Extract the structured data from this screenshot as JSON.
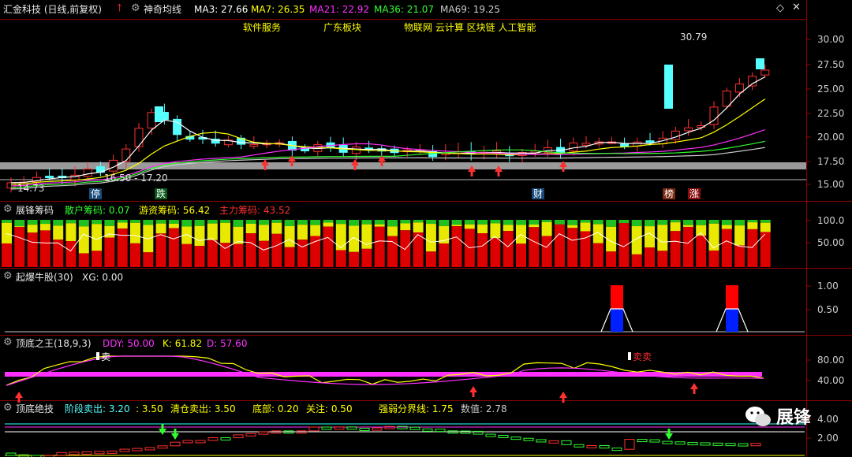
{
  "colors": {
    "up_red": "#ff3030",
    "down_cyan": "#55ffff",
    "ma3": "#ffffff",
    "ma7": "#ffff00",
    "ma21": "#ff30ff",
    "ma36": "#30ff30",
    "ma69": "#cccccc",
    "grid_red": "#7a0000",
    "header_yellow": "#ffff00",
    "magenta": "#ff30ff"
  },
  "panel1": {
    "stock_title": "汇金科技 (日线,前复权)",
    "indicator_name": "神奇均线",
    "ma": [
      {
        "label": "MA3: 27.66"
      },
      {
        "label": "MA7: 26.35"
      },
      {
        "label": "MA21: 22.92"
      },
      {
        "label": "MA36: 21.07"
      },
      {
        "label": "MA69: 19.25"
      }
    ],
    "concepts": [
      "软件服务",
      "广东板块",
      "物联网 云计算 区块链 人工智能"
    ],
    "y_ticks": [
      "30.00",
      "27.50",
      "25.00",
      "22.50",
      "20.00",
      "17.50",
      "15.00"
    ],
    "high_label": "30.79",
    "low_label": "14.73",
    "range_label": "16.50 - 17.20",
    "events": [
      {
        "label": "停"
      },
      {
        "label": "跌"
      },
      {
        "label": "财"
      },
      {
        "label": "榜"
      },
      {
        "label": "涨"
      }
    ]
  },
  "panel2": {
    "title": "展锋筹码",
    "items": [
      {
        "label": "散户筹码: 0.07"
      },
      {
        "label": "游资筹码: 56.42"
      },
      {
        "label": "主力筹码: 43.52"
      }
    ],
    "y_ticks": [
      "100.0",
      "50.00"
    ]
  },
  "panel3": {
    "title": "起爆牛股(30)",
    "value_label": "XG: 0.00",
    "y_ticks": [
      "1.00",
      "0.50"
    ]
  },
  "panel4": {
    "title": "顶底之王(18,9,3)",
    "items": [
      {
        "label": "DDY: 50.00"
      },
      {
        "label": "K: 61.82"
      },
      {
        "label": "D: 57.60"
      }
    ],
    "y_ticks": [
      "80.00",
      "40.00"
    ],
    "sell_labels": [
      "卖",
      "卖卖"
    ]
  },
  "panel5": {
    "title": "顶底绝技",
    "items": [
      {
        "label": "阶段卖出: 3.20"
      },
      {
        "label": ": 3.50"
      },
      {
        "label": "清仓卖出: 3.50"
      },
      {
        "label": "底部: 0.20"
      },
      {
        "label": "关注: 0.50"
      },
      {
        "label": "强弱分界线: 1.75"
      },
      {
        "label": "数值: 2.78"
      }
    ],
    "y_ticks": [
      "4.00",
      "2.00"
    ]
  },
  "watermark": {
    "label": "展锋"
  }
}
